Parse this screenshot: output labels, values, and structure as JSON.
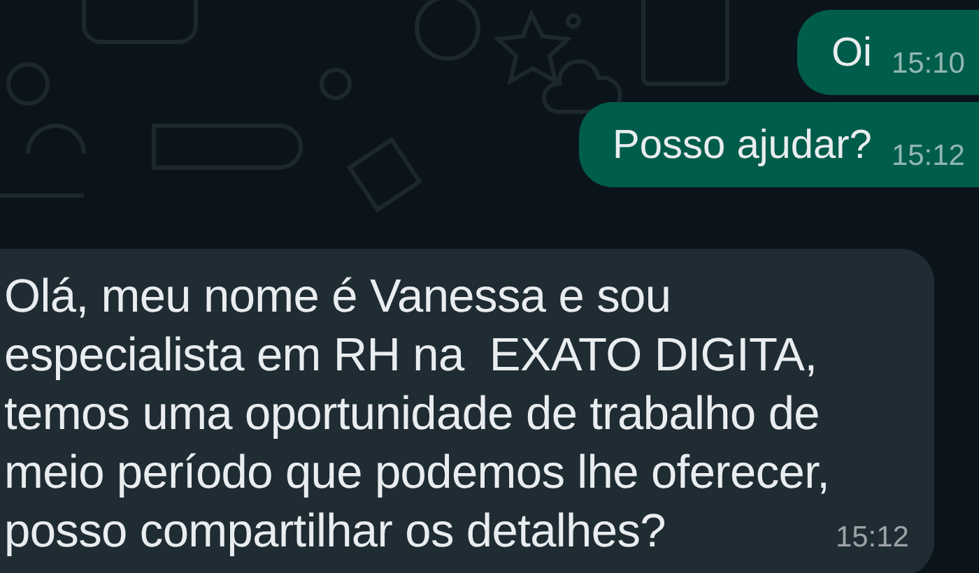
{
  "messages": [
    {
      "kind": "outgoing",
      "text": "Oi",
      "time": "15:10"
    },
    {
      "kind": "outgoing",
      "text": "Posso ajudar?",
      "time": "15:12"
    },
    {
      "kind": "incoming",
      "text": "Olá, meu nome é Vanessa e sou especialista em RH na  EXATO DIGITA, temos uma oportunidade de trabalho de meio período que podemos lhe oferecer, posso compartilhar os detalhes?",
      "time": "15:12"
    }
  ]
}
